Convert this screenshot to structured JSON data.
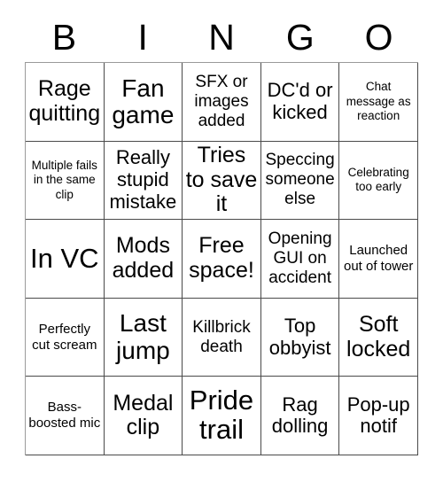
{
  "card": {
    "title": "BINGO",
    "columns": [
      "B",
      "I",
      "N",
      "G",
      "O"
    ],
    "colors": {
      "background": "#ffffff",
      "text": "#000000",
      "grid_line": "#4a4a4a"
    },
    "rows": [
      [
        {
          "text": "Rage quitting",
          "size": "xl"
        },
        {
          "text": "Fan game",
          "size": "xxl"
        },
        {
          "text": "SFX or images added",
          "size": "m"
        },
        {
          "text": "DC'd or kicked",
          "size": "l"
        },
        {
          "text": "Chat message as reaction",
          "size": "xs"
        }
      ],
      [
        {
          "text": "Multiple fails in the same clip",
          "size": "xs"
        },
        {
          "text": "Really stupid mistake",
          "size": "l"
        },
        {
          "text": "Tries to save it",
          "size": "xl"
        },
        {
          "text": "Speccing someone else",
          "size": "m"
        },
        {
          "text": "Celebrating too early",
          "size": "xs"
        }
      ],
      [
        {
          "text": "In VC",
          "size": "max"
        },
        {
          "text": "Mods added",
          "size": "xl"
        },
        {
          "text": "Free space!",
          "size": "xl"
        },
        {
          "text": "Opening GUI on accident",
          "size": "m"
        },
        {
          "text": "Launched out of tower",
          "size": "s"
        }
      ],
      [
        {
          "text": "Perfectly cut scream",
          "size": "s"
        },
        {
          "text": "Last jump",
          "size": "xxl"
        },
        {
          "text": "Killbrick death",
          "size": "m"
        },
        {
          "text": "Top obbyist",
          "size": "l"
        },
        {
          "text": "Soft locked",
          "size": "xl"
        }
      ],
      [
        {
          "text": "Bass-boosted mic",
          "size": "s"
        },
        {
          "text": "Medal clip",
          "size": "xl"
        },
        {
          "text": "Pride trail",
          "size": "max"
        },
        {
          "text": "Rag dolling",
          "size": "l"
        },
        {
          "text": "Pop-up notif",
          "size": "l"
        }
      ]
    ]
  }
}
